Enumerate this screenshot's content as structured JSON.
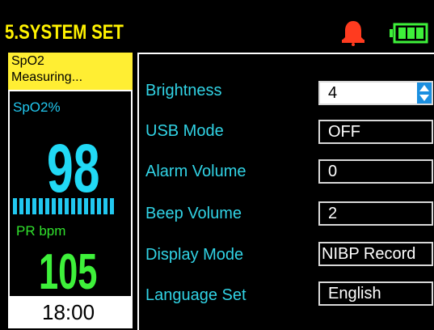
{
  "header": {
    "title": "5.SYSTEM SET",
    "bell_icon": "bell-icon",
    "battery_icon": "battery-icon"
  },
  "left_panel": {
    "status_line1": "SpO2",
    "status_line2": "Measuring...",
    "spo2_label": "SpO2%",
    "spo2_value": "98",
    "pr_label": "PR bpm",
    "pr_value": "105",
    "time": "18:00"
  },
  "settings": [
    {
      "label": "Brightness",
      "value": "4"
    },
    {
      "label": "USB Mode",
      "value": "OFF"
    },
    {
      "label": "Alarm Volume",
      "value": "0"
    },
    {
      "label": "Beep Volume",
      "value": "2"
    },
    {
      "label": "Display Mode",
      "value": "NIBP Record"
    },
    {
      "label": "Language Set",
      "value": "English"
    }
  ],
  "colors": {
    "title": "#fff200",
    "spo2": "#21d9f5",
    "pr": "#3ef13a",
    "label": "#31d3e5",
    "bell": "#ff3b1f",
    "battery": "#3ef13a",
    "spin": "#1b8fe0"
  }
}
